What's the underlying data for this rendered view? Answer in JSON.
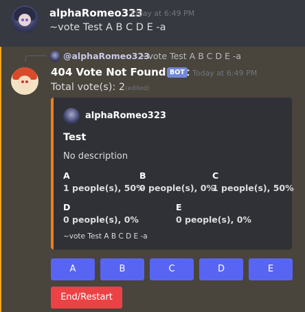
{
  "message1": {
    "author": "alphaRomeo323",
    "timestamp": "Today at 6:49 PM",
    "content": "~vote Test A B C D E -a"
  },
  "message2": {
    "reply": {
      "mention": "@alphaRomeo323",
      "text": "~vote Test A B C D E -a"
    },
    "author": "404 Vote Not Found Bot",
    "bot_tag": "BOT",
    "timestamp": "Today at 6:49 PM",
    "content": "Total vote(s): 2",
    "edited": "(edited)",
    "embed": {
      "author": "alphaRomeo323",
      "title": "Test",
      "description": "No description",
      "fields": [
        {
          "name": "A",
          "value": "1 people(s), 50%"
        },
        {
          "name": "B",
          "value": "0 people(s), 0%"
        },
        {
          "name": "C",
          "value": "1 people(s), 50%"
        },
        {
          "name": "D",
          "value": "0 people(s), 0%"
        },
        {
          "name": "E",
          "value": "0 people(s), 0%"
        }
      ],
      "footer": "~vote Test A B C D E -a",
      "color": "#f07d1b"
    },
    "buttons": [
      "A",
      "B",
      "C",
      "D",
      "E"
    ],
    "end_button": "End/Restart"
  },
  "colors": {
    "highlight_bar": "#faa61a",
    "vote_button": "#5865f2",
    "end_button": "#ed4245",
    "bot_tag": "#7289da"
  }
}
